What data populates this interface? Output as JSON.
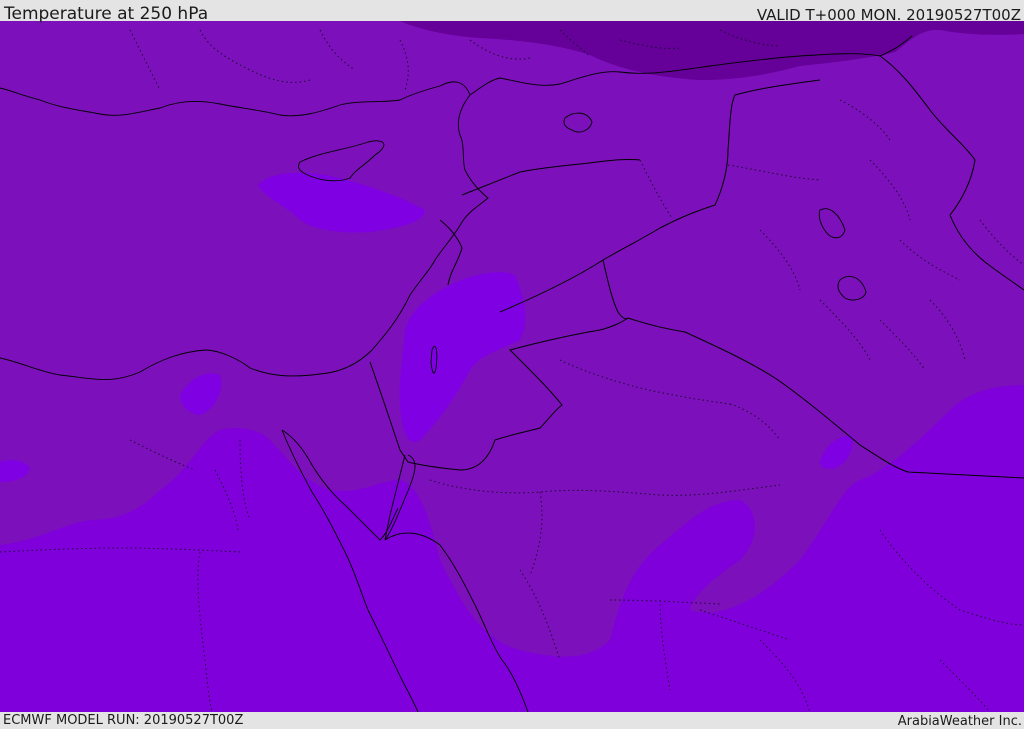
{
  "header": {
    "title": "Temperature at 250 hPa",
    "valid_time": "VALID T+000 MON. 20190527T00Z"
  },
  "footer": {
    "model_run": "ECMWF MODEL RUN: 20190527T00Z",
    "credit": "ArabiaWeather Inc."
  },
  "map": {
    "colors": {
      "warm_band": "#7f00db",
      "mid_band": "#7c10ba",
      "bright_band": "#8000e4",
      "cold_band": "#650099"
    }
  }
}
